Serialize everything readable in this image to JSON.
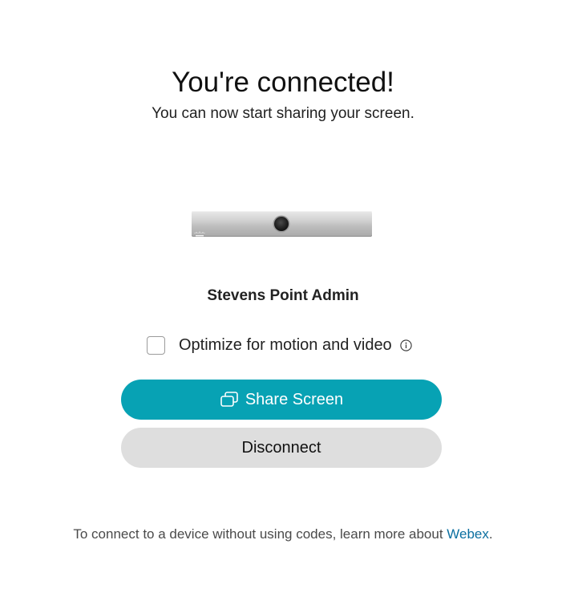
{
  "header": {
    "title": "You're connected!",
    "subtitle": "You can now start sharing your screen."
  },
  "device": {
    "name": "Stevens Point Admin",
    "image_icon": "room-bar-device-image"
  },
  "options": {
    "optimize_label": "Optimize for motion and video",
    "optimize_checked": false,
    "info_icon": "info-icon"
  },
  "buttons": {
    "share_label": "Share Screen",
    "share_icon": "share-screen-icon",
    "disconnect_label": "Disconnect"
  },
  "footer": {
    "text": "To connect to a device without using codes, learn more about ",
    "link_text": "Webex",
    "suffix": "."
  },
  "colors": {
    "share_button": "#07a2b4",
    "disconnect_button": "#dedede",
    "link": "#0b6fa0"
  }
}
